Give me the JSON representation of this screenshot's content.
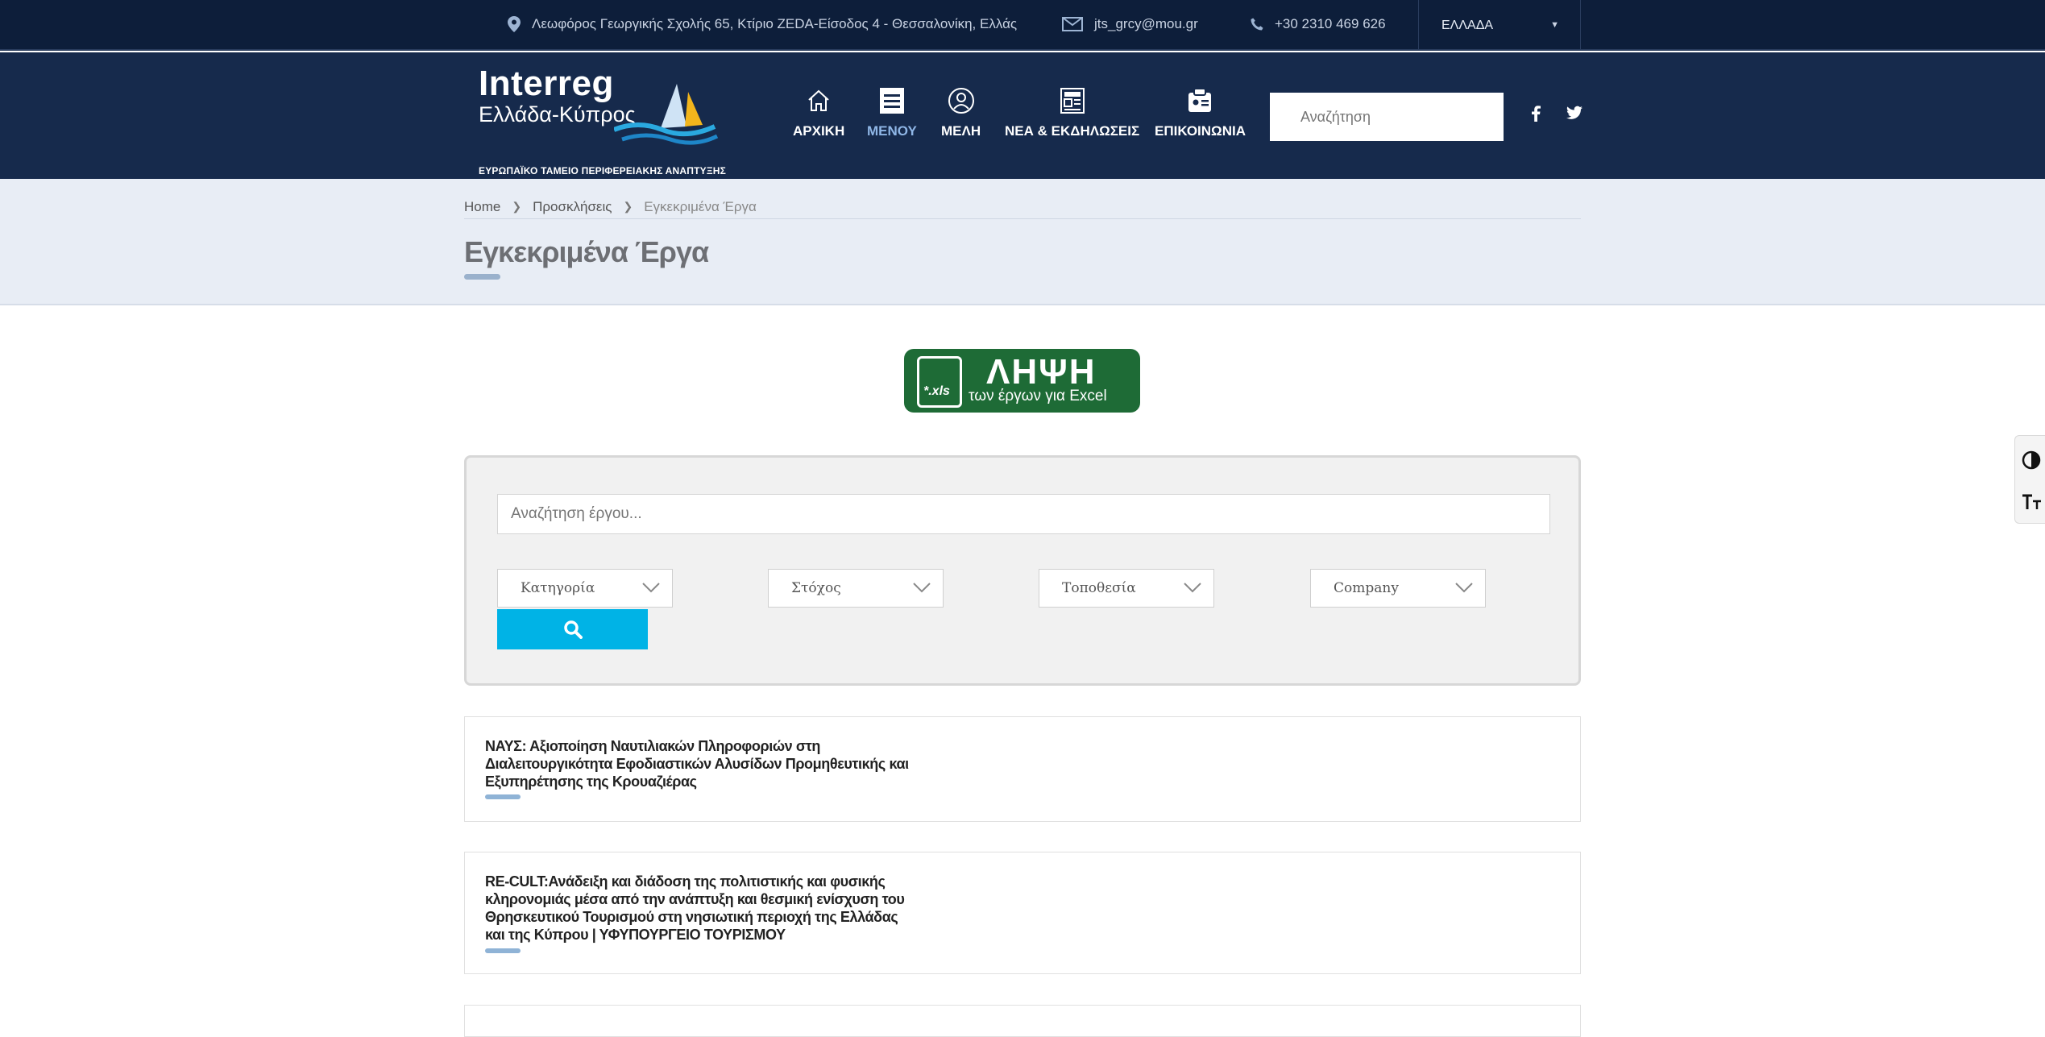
{
  "topbar": {
    "address": "Λεωφόρος Γεωργικής Σχολής 65, Κτίριο ZEDA-Είσοδος 4 - Θεσσαλονίκη, Ελλάς",
    "email": "jts_grcy@mou.gr",
    "phone": "+30 2310 469 626",
    "language": "ΕΛΛΑΔΑ"
  },
  "logo": {
    "line1": "Interreg",
    "line2": "Ελλάδα-Κύπρος",
    "line3": "ΕΥΡΩΠΑΪΚΟ ΤΑΜΕΙΟ ΠΕΡΙΦΕΡΕΙΑΚΗΣ ΑΝΑΠΤΥΞΗΣ"
  },
  "nav": {
    "items": [
      {
        "label": "ΑΡΧΙΚΗ",
        "icon": "home-icon"
      },
      {
        "label": "ΜΕΝΟΥ",
        "icon": "menu-icon",
        "active": true
      },
      {
        "label": "ΜΕΛΗ",
        "icon": "user-icon"
      },
      {
        "label": "ΝΕΑ & ΕΚΔΗΛΩΣΕΙΣ",
        "icon": "news-icon"
      },
      {
        "label": "ΕΠΙΚΟΙΝΩΝΙΑ",
        "icon": "contact-card-icon"
      }
    ],
    "search_placeholder": "Αναζήτηση"
  },
  "breadcrumb": {
    "home": "Home",
    "parent": "Προσκλήσεις",
    "current": "Εγκεκριμένα Έργα"
  },
  "page_title": "Εγκεκριμένα Έργα",
  "download": {
    "file_label": "*.xls",
    "title": "ΛΗΨΗ",
    "subtitle": "των έργων για Excel"
  },
  "search_panel": {
    "query_placeholder": "Αναζήτηση έργου...",
    "filters": [
      "Κατηγορία",
      "Στόχος",
      "Τοποθεσία",
      "Company"
    ]
  },
  "projects": [
    {
      "title": "ΝΑΥΣ: Αξιοποίηση Ναυτιλιακών Πληροφοριών στη Διαλειτουργικότητα Εφοδιαστικών Αλυσίδων Προμηθευτικής και Εξυπηρέτησης της Κρουαζιέρας"
    },
    {
      "title": "RE-CULT:Ανάδειξη και διάδοση της πολιτιστικής και φυσικής κληρονομιάς μέσα από την ανάπτυξη και θεσμική ενίσχυση του Θρησκευτικού Τουρισμού στη νησιωτική περιοχή της Ελλάδας και της Κύπρου | ΥΦΥΠΟΥΡΓΕΙΟ ΤΟΥΡΙΣΜΟΥ"
    }
  ],
  "colors": {
    "topbar": "#0d1e3a",
    "header": "#162a4c",
    "accent": "#00b3e6",
    "download_green": "#1e6b36"
  }
}
